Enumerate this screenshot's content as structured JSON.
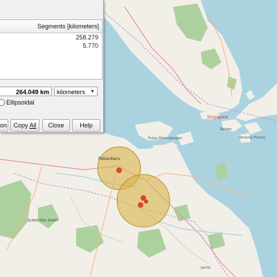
{
  "dialog": {
    "column_header": "Segments [kilometers]",
    "segments": [
      "258.279",
      "5.770"
    ],
    "total": "264.049 km",
    "unit": "kilometers",
    "ellipsoidal_label": "Ellipsoidal",
    "buttons": {
      "new": "on",
      "copy_prefix": "Copy ",
      "copy_mnemonic": "All",
      "close": "Close",
      "help": "Help"
    }
  },
  "map_labels": {
    "pekanbaru": "Pekanbaru",
    "singapore": "Singapore",
    "batam": "Batam",
    "tanjung_pinang": "Tanjung Pinang",
    "jambi": "Jambi",
    "pulau_pebengkapan": "Pulau Pebengkapan",
    "sumatera_barat": "SUMATERA BARAT"
  },
  "colors": {
    "sea": "#aad3df",
    "land": "#f2efe9",
    "buffer_fill": "#d9b24a",
    "buffer_stroke": "#b58d2a",
    "marker": "#d7472b"
  }
}
